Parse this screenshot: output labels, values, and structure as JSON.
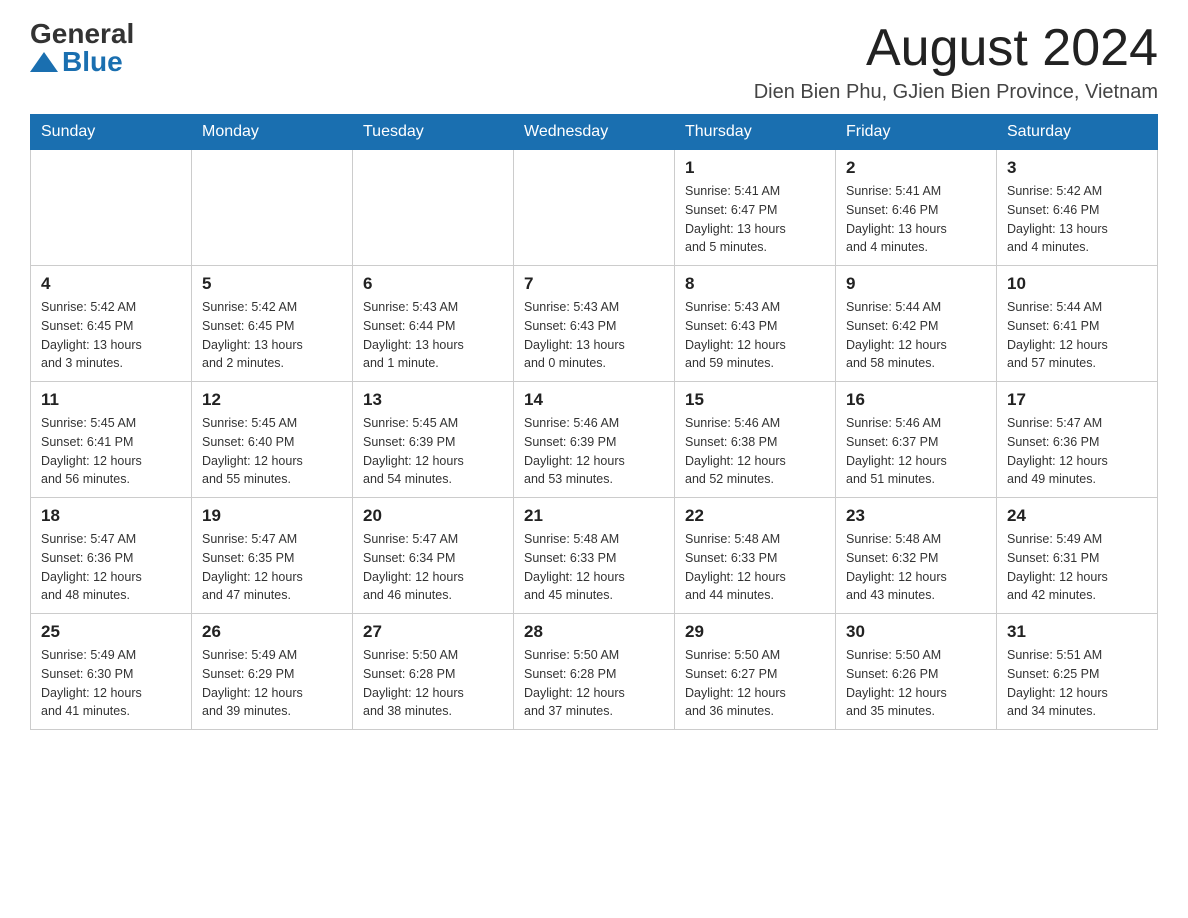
{
  "logo": {
    "general": "General",
    "blue": "Blue"
  },
  "header": {
    "month_year": "August 2024",
    "location": "Dien Bien Phu, GJien Bien Province, Vietnam"
  },
  "weekdays": [
    "Sunday",
    "Monday",
    "Tuesday",
    "Wednesday",
    "Thursday",
    "Friday",
    "Saturday"
  ],
  "weeks": [
    [
      {
        "day": "",
        "info": ""
      },
      {
        "day": "",
        "info": ""
      },
      {
        "day": "",
        "info": ""
      },
      {
        "day": "",
        "info": ""
      },
      {
        "day": "1",
        "info": "Sunrise: 5:41 AM\nSunset: 6:47 PM\nDaylight: 13 hours\nand 5 minutes."
      },
      {
        "day": "2",
        "info": "Sunrise: 5:41 AM\nSunset: 6:46 PM\nDaylight: 13 hours\nand 4 minutes."
      },
      {
        "day": "3",
        "info": "Sunrise: 5:42 AM\nSunset: 6:46 PM\nDaylight: 13 hours\nand 4 minutes."
      }
    ],
    [
      {
        "day": "4",
        "info": "Sunrise: 5:42 AM\nSunset: 6:45 PM\nDaylight: 13 hours\nand 3 minutes."
      },
      {
        "day": "5",
        "info": "Sunrise: 5:42 AM\nSunset: 6:45 PM\nDaylight: 13 hours\nand 2 minutes."
      },
      {
        "day": "6",
        "info": "Sunrise: 5:43 AM\nSunset: 6:44 PM\nDaylight: 13 hours\nand 1 minute."
      },
      {
        "day": "7",
        "info": "Sunrise: 5:43 AM\nSunset: 6:43 PM\nDaylight: 13 hours\nand 0 minutes."
      },
      {
        "day": "8",
        "info": "Sunrise: 5:43 AM\nSunset: 6:43 PM\nDaylight: 12 hours\nand 59 minutes."
      },
      {
        "day": "9",
        "info": "Sunrise: 5:44 AM\nSunset: 6:42 PM\nDaylight: 12 hours\nand 58 minutes."
      },
      {
        "day": "10",
        "info": "Sunrise: 5:44 AM\nSunset: 6:41 PM\nDaylight: 12 hours\nand 57 minutes."
      }
    ],
    [
      {
        "day": "11",
        "info": "Sunrise: 5:45 AM\nSunset: 6:41 PM\nDaylight: 12 hours\nand 56 minutes."
      },
      {
        "day": "12",
        "info": "Sunrise: 5:45 AM\nSunset: 6:40 PM\nDaylight: 12 hours\nand 55 minutes."
      },
      {
        "day": "13",
        "info": "Sunrise: 5:45 AM\nSunset: 6:39 PM\nDaylight: 12 hours\nand 54 minutes."
      },
      {
        "day": "14",
        "info": "Sunrise: 5:46 AM\nSunset: 6:39 PM\nDaylight: 12 hours\nand 53 minutes."
      },
      {
        "day": "15",
        "info": "Sunrise: 5:46 AM\nSunset: 6:38 PM\nDaylight: 12 hours\nand 52 minutes."
      },
      {
        "day": "16",
        "info": "Sunrise: 5:46 AM\nSunset: 6:37 PM\nDaylight: 12 hours\nand 51 minutes."
      },
      {
        "day": "17",
        "info": "Sunrise: 5:47 AM\nSunset: 6:36 PM\nDaylight: 12 hours\nand 49 minutes."
      }
    ],
    [
      {
        "day": "18",
        "info": "Sunrise: 5:47 AM\nSunset: 6:36 PM\nDaylight: 12 hours\nand 48 minutes."
      },
      {
        "day": "19",
        "info": "Sunrise: 5:47 AM\nSunset: 6:35 PM\nDaylight: 12 hours\nand 47 minutes."
      },
      {
        "day": "20",
        "info": "Sunrise: 5:47 AM\nSunset: 6:34 PM\nDaylight: 12 hours\nand 46 minutes."
      },
      {
        "day": "21",
        "info": "Sunrise: 5:48 AM\nSunset: 6:33 PM\nDaylight: 12 hours\nand 45 minutes."
      },
      {
        "day": "22",
        "info": "Sunrise: 5:48 AM\nSunset: 6:33 PM\nDaylight: 12 hours\nand 44 minutes."
      },
      {
        "day": "23",
        "info": "Sunrise: 5:48 AM\nSunset: 6:32 PM\nDaylight: 12 hours\nand 43 minutes."
      },
      {
        "day": "24",
        "info": "Sunrise: 5:49 AM\nSunset: 6:31 PM\nDaylight: 12 hours\nand 42 minutes."
      }
    ],
    [
      {
        "day": "25",
        "info": "Sunrise: 5:49 AM\nSunset: 6:30 PM\nDaylight: 12 hours\nand 41 minutes."
      },
      {
        "day": "26",
        "info": "Sunrise: 5:49 AM\nSunset: 6:29 PM\nDaylight: 12 hours\nand 39 minutes."
      },
      {
        "day": "27",
        "info": "Sunrise: 5:50 AM\nSunset: 6:28 PM\nDaylight: 12 hours\nand 38 minutes."
      },
      {
        "day": "28",
        "info": "Sunrise: 5:50 AM\nSunset: 6:28 PM\nDaylight: 12 hours\nand 37 minutes."
      },
      {
        "day": "29",
        "info": "Sunrise: 5:50 AM\nSunset: 6:27 PM\nDaylight: 12 hours\nand 36 minutes."
      },
      {
        "day": "30",
        "info": "Sunrise: 5:50 AM\nSunset: 6:26 PM\nDaylight: 12 hours\nand 35 minutes."
      },
      {
        "day": "31",
        "info": "Sunrise: 5:51 AM\nSunset: 6:25 PM\nDaylight: 12 hours\nand 34 minutes."
      }
    ]
  ]
}
